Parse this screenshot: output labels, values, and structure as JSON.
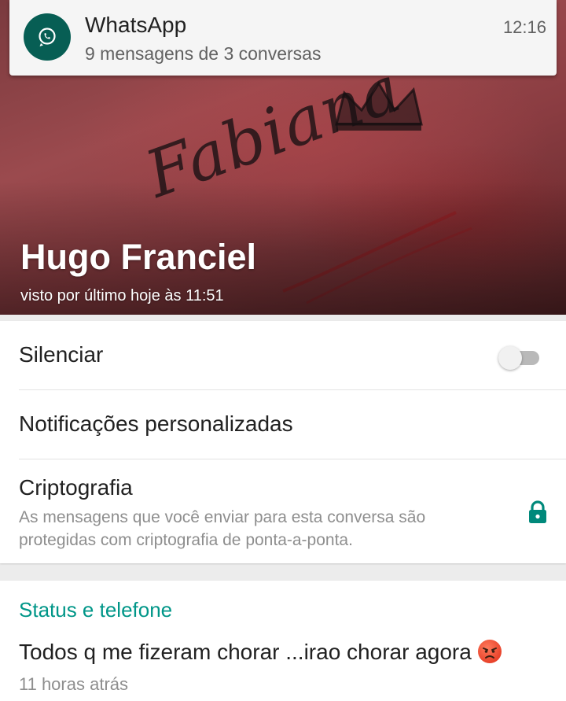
{
  "notification": {
    "app_name": "WhatsApp",
    "time": "12:16",
    "text": "9 mensagens de 3 conversas",
    "icon": "whatsapp-icon"
  },
  "header": {
    "contact_name": "Hugo Franciel",
    "last_seen": "visto por último hoje às 11:51",
    "photo_script": "Fabiana"
  },
  "settings": {
    "mute": {
      "label": "Silenciar",
      "enabled": false
    },
    "custom_notifications": {
      "label": "Notificações personalizadas"
    },
    "encryption": {
      "label": "Criptografia",
      "description": "As mensagens que você enviar para esta conversa são protegidas com criptografia de ponta-a-ponta.",
      "icon": "lock-icon"
    }
  },
  "status_section": {
    "title": "Status e telefone",
    "status_text": "Todos q me fizeram chorar ...irao chorar agora",
    "status_emoji": "angry-face-icon",
    "status_time": "11 horas atrás"
  },
  "colors": {
    "accent": "#009688",
    "whatsapp_dark": "#075e54",
    "lock": "#00897b"
  }
}
